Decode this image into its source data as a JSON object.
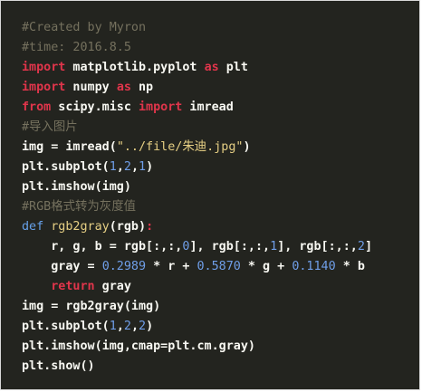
{
  "colors": {
    "background": "#23241f",
    "comment": "#75715e",
    "keyword": "#e0354b",
    "def": "#66a0e8",
    "function": "#e6cf84",
    "number": "#6f9ee8",
    "string": "#e6cf84",
    "text": "#f8f8f2"
  },
  "code_lines": [
    [
      [
        "cm",
        "#Created by Myron"
      ]
    ],
    [
      [
        "cm",
        "#time: 2016.8.5"
      ]
    ],
    [
      [
        "kw",
        "import"
      ],
      [
        "tx",
        " matplotlib.pyplot "
      ],
      [
        "kw",
        "as"
      ],
      [
        "tx",
        " plt"
      ]
    ],
    [
      [
        "kw",
        "import"
      ],
      [
        "tx",
        " numpy "
      ],
      [
        "kw",
        "as"
      ],
      [
        "tx",
        " np"
      ]
    ],
    [
      [
        "kw",
        "from"
      ],
      [
        "tx",
        " scipy.misc "
      ],
      [
        "kw",
        "import"
      ],
      [
        "tx",
        " imread"
      ]
    ],
    [
      [
        "cm",
        "#导入图片"
      ]
    ],
    [
      [
        "tx",
        "img = imread("
      ],
      [
        "str",
        "\"../file/朱迪.jpg\""
      ],
      [
        "tx",
        ")"
      ]
    ],
    [
      [
        "tx",
        "plt.subplot("
      ],
      [
        "num",
        "1"
      ],
      [
        "tx",
        ","
      ],
      [
        "num",
        "2"
      ],
      [
        "tx",
        ","
      ],
      [
        "num",
        "1"
      ],
      [
        "tx",
        ")"
      ]
    ],
    [
      [
        "tx",
        "plt.imshow(img)"
      ]
    ],
    [
      [
        "cm",
        "#RGB格式转为灰度值"
      ]
    ],
    [
      [
        "def",
        "def"
      ],
      [
        "tx",
        " "
      ],
      [
        "fn",
        "rgb2gray"
      ],
      [
        "tx",
        "(rgb)"
      ],
      [
        "kw",
        ":"
      ]
    ],
    [
      [
        "tx",
        "    r, g, b = rgb[:,:,"
      ],
      [
        "num",
        "0"
      ],
      [
        "tx",
        "], rgb[:,:,"
      ],
      [
        "num",
        "1"
      ],
      [
        "tx",
        "], rgb[:,:,"
      ],
      [
        "num",
        "2"
      ],
      [
        "tx",
        "]"
      ]
    ],
    [
      [
        "tx",
        "    gray = "
      ],
      [
        "num",
        "0.2989"
      ],
      [
        "tx",
        " * r + "
      ],
      [
        "num",
        "0.5870"
      ],
      [
        "tx",
        " * g + "
      ],
      [
        "num",
        "0.1140"
      ],
      [
        "tx",
        " * b"
      ]
    ],
    [
      [
        "tx",
        "    "
      ],
      [
        "kw",
        "return"
      ],
      [
        "tx",
        " gray"
      ]
    ],
    [
      [
        "tx",
        "img = rgb2gray(img)"
      ]
    ],
    [
      [
        "tx",
        "plt.subplot("
      ],
      [
        "num",
        "1"
      ],
      [
        "tx",
        ","
      ],
      [
        "num",
        "2"
      ],
      [
        "tx",
        ","
      ],
      [
        "num",
        "2"
      ],
      [
        "tx",
        ")"
      ]
    ],
    [
      [
        "tx",
        "plt.imshow(img,cmap=plt.cm.gray)"
      ]
    ],
    [
      [
        "tx",
        "plt.show()"
      ]
    ]
  ]
}
